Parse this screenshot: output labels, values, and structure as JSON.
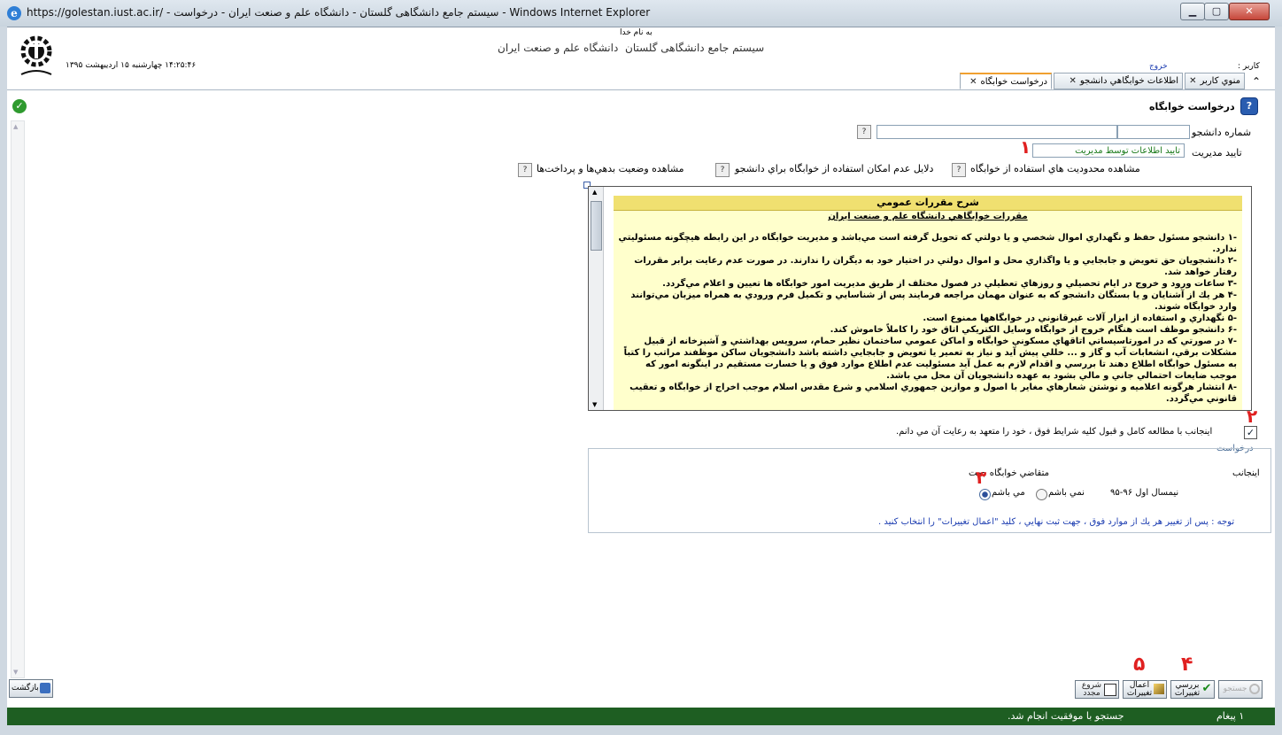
{
  "window": {
    "title": "https://golestan.iust.ac.ir/ - سیستم جامع دانشگاهی گلستان - دانشگاه علم و صنعت ایران - درخواست - Windows Internet Explorer"
  },
  "header": {
    "bismillah": "به نام خدا",
    "system_name": "سیستم جامع دانشگاهی گلستان",
    "university_name": "دانشگاه علم و صنعت ایران",
    "user_label": "کاربر :",
    "logout_label": "خروج",
    "datetime": "۱۴:۲۵:۴۶ چهارشنبه ۱۵ اردیبهشت ۱۳۹۵"
  },
  "tabs": [
    {
      "label": "منوي كاربر"
    },
    {
      "label": "اطلاعات خوابگاهي دانشجو"
    },
    {
      "label": "درخواست خوابگاه"
    }
  ],
  "page": {
    "title": "درخواست خوابگاه"
  },
  "form": {
    "student_number_label": "شماره دانشجو",
    "student_number_value": "",
    "student_name_value": "",
    "management_approval_label": "تاييد مديريت",
    "management_approval_value": "تاييد اطلاعات توسط مديريت",
    "help_mark": "?"
  },
  "links": {
    "restrictions": "مشاهده محدوديت هاي استفاده از خوابگاه",
    "reasons": "دلايل عدم امكان استفاده از خوابگاه براي دانشجو",
    "debts": "مشاهده وضعيت بدهي‌ها و پرداخت‌ها"
  },
  "rules": {
    "heading": "شرح مقررات عمومي",
    "subheading": "مقررات خوابگاهي دانشگاه علم و صنعت ايران",
    "items": [
      "-۱   دانشجو مسئول حفظ و نگهداري اموال شخصي و يا دولتي كه تحويل گرفته است مي‌باشد و مديريت خوابگاه در اين رابطه هيچگونه مسئوليتي ندارد.",
      "-۲   دانشجويان حق تعويض و جابجايي و يا واگذاري محل و اموال دولتي در اختيار خود به ديگران را ندارند. در صورت عدم رعايت برابر مقررات رفتار خواهد شد.",
      "-۳   ساعات ورود و خروج در ايام تحصيلي و روزهاي تعطيلي در فصول مختلف از طريق مديريت امور خوابگاه ها تعيين و اعلام مي‌گردد.",
      "-۴   هر يك از آشنايان و يا بستگان دانشجو كه به عنوان مهمان مراجعه فرمايند پس از شناسايي و تكميل فرم ورودي به همراه ميزبان مي‌توانند وارد خوابگاه شوند.",
      "-۵   نگهداري و استفاده از ابزار آلات غيرقانوني در خوابگاهها ممنوع است.",
      "-۶   دانشجو موظف است هنگام خروج از خوابگاه وسايل الكتريكي اتاق خود را كاملاً خاموش كند.",
      "-۷   در صورتي كه در امورتاسيساتي اتاقهاي مسكوني خوابگاه و اماكن عمومي ساختمان نظير حمام، سرويس بهداشتي و آشپزخانه از قبيل مشكلات برقي، انشعابات آب و گاز و ... خللي پيش آيد و نياز به تعمير يا تعويض و جابجايي داشته باشد دانشجويان ساكن موظفند مراتب را كتباً به مسئول خوابگاه اطلاع دهند تا بررسي و اقدام لازم به عمل آيد مسئوليت عدم اطلاع موارد فوق و يا خسارت مستقيم در اينگونه امور كه موجب ضايعات احتمالي جاني و مالي بشود به عهده دانشجويان آن محل مي باشد.",
      "-۸   انتشار هرگونه اعلاميه و نوشتن شعارهاي مغاير با اصول و موازين جمهوري اسلامي و شرع مقدس اسلام موجب اخراج از خوابگاه و تعقيب قانوني مي‌گردد."
    ]
  },
  "agreement": {
    "checked": true,
    "text": "اينجانب با مطالعه كامل و قبول كليه شرايط فوق ، خود را متعهد به رعايت آن مي دانم."
  },
  "request": {
    "legend": "درخواست",
    "applicant_label": "اينجانب",
    "applicant_text": "متقاضي خوابگاه جهت",
    "term": "نيمسال اول ۹۶-۹۵",
    "option_no": "نمي باشم",
    "option_yes": "مي باشم",
    "selected": "yes",
    "note": "توجه : پس از تغيير هر يك از موارد فوق ، جهت ثبت نهايي ، كليد \"اعمال تغييرات\" را انتخاب كنيد ."
  },
  "annotations": [
    "۱",
    "۲",
    "۳",
    "۴",
    "۵"
  ],
  "buttons": {
    "back": "بازگشت",
    "search": "جستجو",
    "review": "بررسي تغييرات",
    "apply": "اعمال تغييرات",
    "restart": "شروع مجدد"
  },
  "status": {
    "message_count": "۱ پیغام",
    "message": "جستجو با موفقيت انجام شد."
  },
  "colors": {
    "status_bar": "#1e5e22",
    "rules_background": "#ffffcc",
    "rules_heading": "#f0e070",
    "annotation_red": "#e02020"
  }
}
